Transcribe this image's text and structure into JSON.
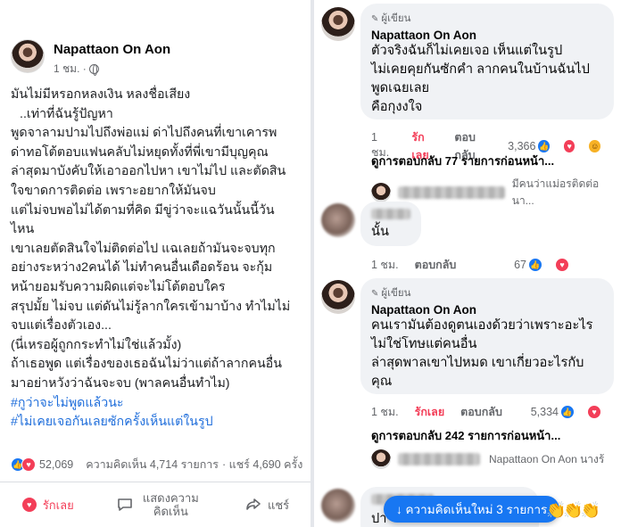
{
  "post": {
    "author": "Napattaon On Aon",
    "time": "1 ชม. ·",
    "body_lines": [
      "มันไม่มีหรอกหลงเงิน หลงชื่อเสียง",
      " ..เท่าที่ฉันรู้ปัญหา",
      "พูดจาลามปามไปถึงพ่อแม่ ด่าไปถึงคนที่เขาเคารพ",
      "ด่าทอโต้ตอบแฟนคลับไม่หยุดทั้งที่พี่เขามีบุญคุณ",
      "ล่าสุดมาบังคับให้เอาออกไปหา เขาไม่ไป และตัดสิน",
      "ใจขาดการติดต่อ เพราะอยากให้มันจบ",
      "แต่ไม่จบพอไม่ได้ตามที่คิด มีขู่ว่าจะแฉวันนั้นนี้วัน",
      "ไหน",
      "เขาเลยตัดสินใจไม่ติดต่อไป แฉเลยถ้ามันจะจบทุก",
      "อย่างระหว่าง2คนได้ ไม่ทำคนอื่นเดือดร้อน จะกุ้ม",
      "หน้ายอมรับความผิดแต่จะไม่โต้ตอบใคร",
      "สรุปมั้ย ไม่จบ แต่ดันไม่รู้ลากใครเข้ามาบ้าง ทำไมไม่",
      "จบแต่เรื่องตัวเอง...",
      "(นี่เหรอผู้ถูกกระทำไม่ใช่แล้วมั้ง)",
      "ถ้าเธอพูด แต่เรื่องของเธอฉันไม่ว่าแต่ถ้าลากคนอื่น",
      "มาอย่าหวังว่าฉันจะจบ (พาลคนอื่นทำไม)"
    ],
    "hashtags": [
      "#กูว่าจะไม่พูดแล้วนะ",
      "#ไม่เคยเจอกันเลยซักครั้งเห็นแต่ในรูป"
    ],
    "reaction_count": "52,069",
    "comment_count": "ความคิดเห็น 4,714 รายการ",
    "share_count": "· แชร์ 4,690 ครั้ง",
    "actions": {
      "love": "รักเลย",
      "comment": "แสดงความคิดเห็น",
      "share": "แชร์"
    }
  },
  "comments": [
    {
      "badge": "ผู้เขียน",
      "name": "Napattaon On Aon",
      "lines": [
        "ตัวจริงฉันก็ไม่เคยเจอ เห็นแต่ในรูป",
        "ไม่เคยคุยกันซักคำ ลากคนในบ้านฉันไป",
        "พูดเฉยเลย",
        "คือกุงงใจ"
      ],
      "time": "1 ชม.",
      "love": "รักเลย",
      "reply": "ตอบกลับ",
      "count": "3,366",
      "view_replies": "ดูการตอบกลับ 77 รายการก่อนหน้า...",
      "preview": "มีคนว่าแม่อรติดต่อนา..."
    },
    {
      "lines": [
        "นั้น"
      ],
      "time": "1 ชม.",
      "reply": "ตอบกลับ",
      "count": "67"
    },
    {
      "badge": "ผู้เขียน",
      "name": "Napattaon On Aon",
      "lines": [
        "คนเรามันต้องดูตนเองด้วยว่าเพราะอะไร",
        "ไม่ใช่โทษแต่คนอื่น",
        "ล่าสุดพาลเขาไปหมด เขาเกี่ยวอะไรกับ",
        "คุณ"
      ],
      "time": "1 ชม.",
      "love": "รักเลย",
      "reply": "ตอบกลับ",
      "count": "5,334",
      "view_replies": "ดูการตอบกลับ 242 รายการก่อนหน้า...",
      "preview": "Napattaon On Aon นางร้"
    }
  ],
  "partial_comment_start": "ปา",
  "new_comments_pill": "↓ ความคิดเห็นใหม่ 3 รายการ",
  "colors": {
    "link": "#216fdb",
    "love": "#f33e58",
    "like": "#1877f2",
    "bubble": "#f0f2f5"
  }
}
